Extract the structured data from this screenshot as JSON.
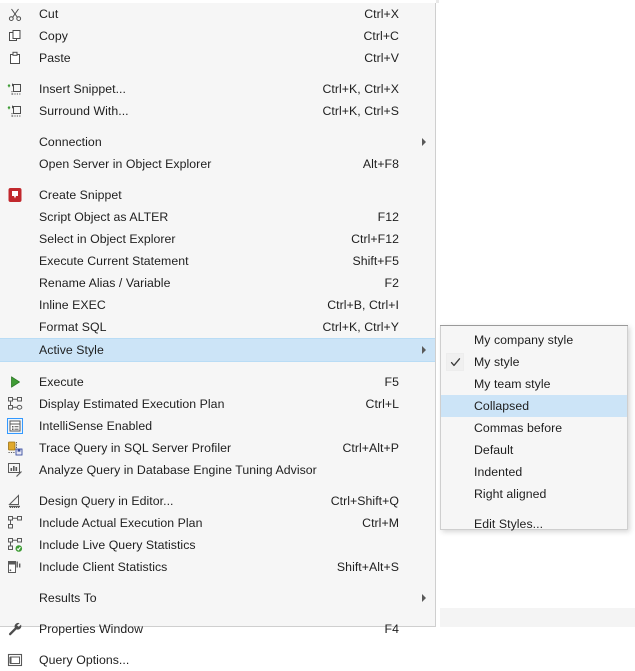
{
  "app": {
    "context": "SQL Server Management Studio query editor context menu"
  },
  "main_menu": {
    "name": "query-editor-context-menu",
    "groups": [
      {
        "items": [
          {
            "icon": "cut-icon",
            "label": "Cut",
            "shortcut": "Ctrl+X",
            "submenu": false,
            "selected": false
          },
          {
            "icon": "copy-icon",
            "label": "Copy",
            "shortcut": "Ctrl+C",
            "submenu": false,
            "selected": false
          },
          {
            "icon": "paste-icon",
            "label": "Paste",
            "shortcut": "Ctrl+V",
            "submenu": false,
            "selected": false
          }
        ]
      },
      {
        "items": [
          {
            "icon": "insert-snippet-icon",
            "label": "Insert Snippet...",
            "shortcut": "Ctrl+K, Ctrl+X",
            "submenu": false,
            "selected": false
          },
          {
            "icon": "surround-with-icon",
            "label": "Surround With...",
            "shortcut": "Ctrl+K, Ctrl+S",
            "submenu": false,
            "selected": false
          }
        ]
      },
      {
        "items": [
          {
            "icon": "none",
            "label": "Connection",
            "shortcut": "",
            "submenu": true,
            "selected": false
          },
          {
            "icon": "none",
            "label": "Open Server in Object Explorer",
            "shortcut": "Alt+F8",
            "submenu": false,
            "selected": false
          }
        ]
      },
      {
        "items": [
          {
            "icon": "create-snippet-icon",
            "label": "Create Snippet",
            "shortcut": "",
            "submenu": false,
            "selected": false
          },
          {
            "icon": "none",
            "label": "Script Object as ALTER",
            "shortcut": "F12",
            "submenu": false,
            "selected": false
          },
          {
            "icon": "none",
            "label": "Select in Object Explorer",
            "shortcut": "Ctrl+F12",
            "submenu": false,
            "selected": false
          },
          {
            "icon": "none",
            "label": "Execute Current Statement",
            "shortcut": "Shift+F5",
            "submenu": false,
            "selected": false
          },
          {
            "icon": "none",
            "label": "Rename Alias / Variable",
            "shortcut": "F2",
            "submenu": false,
            "selected": false
          },
          {
            "icon": "none",
            "label": "Inline EXEC",
            "shortcut": "Ctrl+B, Ctrl+I",
            "submenu": false,
            "selected": false
          },
          {
            "icon": "none",
            "label": "Format SQL",
            "shortcut": "Ctrl+K, Ctrl+Y",
            "submenu": false,
            "selected": false
          },
          {
            "icon": "none",
            "label": "Active Style",
            "shortcut": "",
            "submenu": true,
            "selected": true
          }
        ]
      },
      {
        "items": [
          {
            "icon": "execute-icon",
            "label": "Execute",
            "shortcut": "F5",
            "submenu": false,
            "selected": false
          },
          {
            "icon": "estimated-plan-icon",
            "label": "Display Estimated Execution Plan",
            "shortcut": "Ctrl+L",
            "submenu": false,
            "selected": false
          },
          {
            "icon": "intellisense-icon",
            "label": "IntelliSense Enabled",
            "shortcut": "",
            "submenu": false,
            "selected": false
          },
          {
            "icon": "trace-query-icon",
            "label": "Trace Query in SQL Server Profiler",
            "shortcut": "Ctrl+Alt+P",
            "submenu": false,
            "selected": false
          },
          {
            "icon": "tuning-advisor-icon",
            "label": "Analyze Query in Database Engine Tuning Advisor",
            "shortcut": "",
            "submenu": false,
            "selected": false
          }
        ]
      },
      {
        "items": [
          {
            "icon": "design-query-icon",
            "label": "Design Query in Editor...",
            "shortcut": "Ctrl+Shift+Q",
            "submenu": false,
            "selected": false
          },
          {
            "icon": "actual-plan-icon",
            "label": "Include Actual Execution Plan",
            "shortcut": "Ctrl+M",
            "submenu": false,
            "selected": false
          },
          {
            "icon": "live-query-stats-icon",
            "label": "Include Live Query Statistics",
            "shortcut": "",
            "submenu": false,
            "selected": false
          },
          {
            "icon": "client-stats-icon",
            "label": "Include Client Statistics",
            "shortcut": "Shift+Alt+S",
            "submenu": false,
            "selected": false
          }
        ]
      },
      {
        "items": [
          {
            "icon": "none",
            "label": "Results To",
            "shortcut": "",
            "submenu": true,
            "selected": false
          }
        ]
      },
      {
        "items": [
          {
            "icon": "properties-window-icon",
            "label": "Properties Window",
            "shortcut": "F4",
            "submenu": false,
            "selected": false
          }
        ]
      },
      {
        "items": [
          {
            "icon": "query-options-icon",
            "label": "Query Options...",
            "shortcut": "",
            "submenu": false,
            "selected": false
          }
        ]
      }
    ]
  },
  "submenu": {
    "name": "active-style-submenu",
    "groups": [
      {
        "items": [
          {
            "label": "My company style",
            "checked": false,
            "selected": false
          },
          {
            "label": "My style",
            "checked": true,
            "selected": false
          },
          {
            "label": "My team style",
            "checked": false,
            "selected": false
          },
          {
            "label": "Collapsed",
            "checked": false,
            "selected": true
          },
          {
            "label": "Commas before",
            "checked": false,
            "selected": false
          },
          {
            "label": "Default",
            "checked": false,
            "selected": false
          },
          {
            "label": "Indented",
            "checked": false,
            "selected": false
          },
          {
            "label": "Right aligned",
            "checked": false,
            "selected": false
          }
        ]
      },
      {
        "items": [
          {
            "label": "Edit Styles...",
            "checked": false,
            "selected": false
          }
        ]
      }
    ]
  },
  "colors": {
    "menu_background": "#f6f6f6",
    "menu_border": "#cfcfcf",
    "highlight": "#cce4f7",
    "text": "#1e1e1e",
    "separator": "#e0e0e0",
    "execute_green": "#3f9c35",
    "create_snippet_red": "#c1282d",
    "intellisense_blue": "#3399ff"
  }
}
